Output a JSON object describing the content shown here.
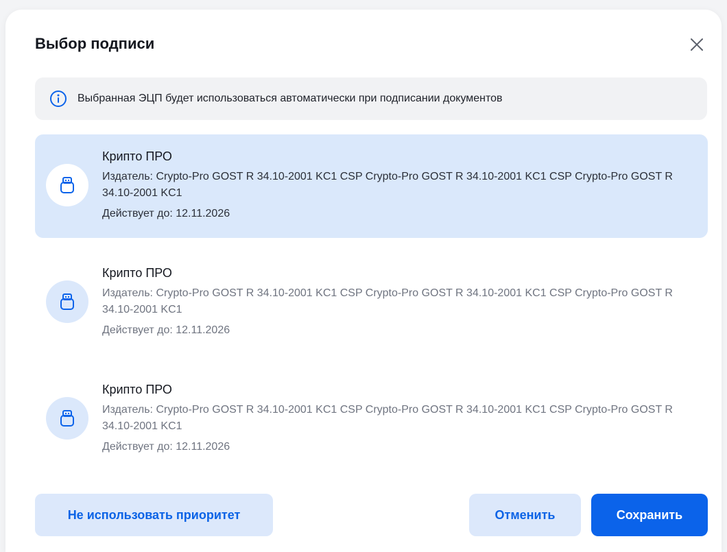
{
  "dialog": {
    "title": "Выбор подписи",
    "close_icon": "close-icon"
  },
  "info": {
    "icon": "info-icon",
    "text": "Выбранная ЭЦП будет использоваться автоматически при подписании документов"
  },
  "signatures": [
    {
      "icon": "usb-token-icon",
      "name": "Крипто ПРО",
      "issuer": "Издатель: Crypto-Pro GOST R 34.10-2001 KC1 CSP Crypto-Pro GOST R 34.10-2001 KC1 CSP Crypto-Pro GOST R 34.10-2001 KC1",
      "valid_until": "Действует до: 12.11.2026",
      "selected": true
    },
    {
      "icon": "usb-token-icon",
      "name": "Крипто ПРО",
      "issuer": "Издатель: Crypto-Pro GOST R 34.10-2001 KC1 CSP Crypto-Pro GOST R 34.10-2001 KC1 CSP Crypto-Pro GOST R 34.10-2001 KC1",
      "valid_until": "Действует до: 12.11.2026",
      "selected": false
    },
    {
      "icon": "usb-token-icon",
      "name": "Крипто ПРО",
      "issuer": "Издатель: Crypto-Pro GOST R 34.10-2001 KC1 CSP Crypto-Pro GOST R 34.10-2001 KC1 CSP Crypto-Pro GOST R 34.10-2001 KC1",
      "valid_until": "Действует до: 12.11.2026",
      "selected": false
    }
  ],
  "buttons": {
    "no_priority": "Не использовать приоритет",
    "cancel": "Отменить",
    "save": "Сохранить"
  },
  "colors": {
    "accent": "#0b63ea",
    "selected_bg": "#dae8fb",
    "info_bg": "#f1f2f4",
    "secondary_btn_bg": "#dce8fb"
  }
}
